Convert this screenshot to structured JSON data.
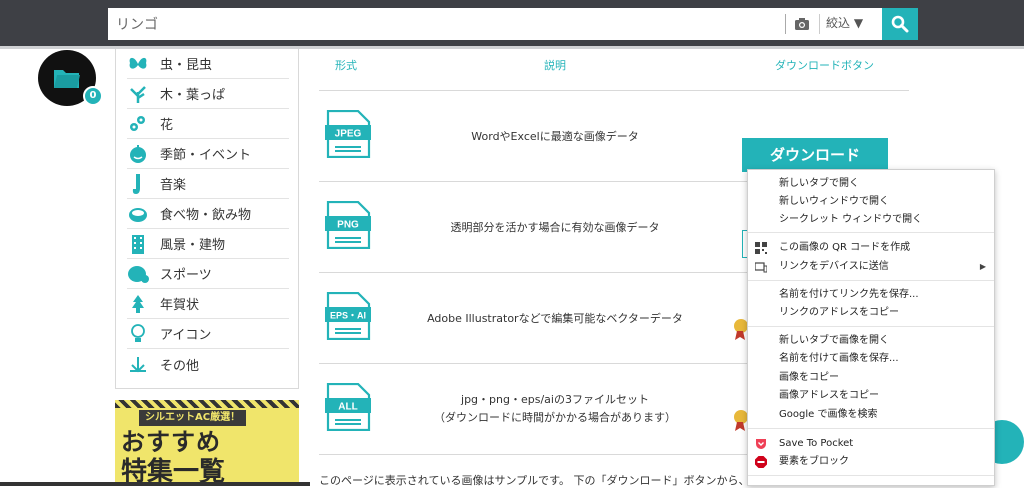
{
  "search": {
    "value": "リンゴ",
    "filter_label": "絞込 ▼"
  },
  "folder": {
    "count": "0"
  },
  "sidebar": {
    "items": [
      {
        "label": "虫・昆虫",
        "icon": "butterfly-icon"
      },
      {
        "label": "木・葉っぱ",
        "icon": "leaf-icon"
      },
      {
        "label": "花",
        "icon": "flower-icon"
      },
      {
        "label": "季節・イベント",
        "icon": "pumpkin-icon"
      },
      {
        "label": "音楽",
        "icon": "saxophone-icon"
      },
      {
        "label": "食べ物・飲み物",
        "icon": "food-icon"
      },
      {
        "label": "風景・建物",
        "icon": "building-icon"
      },
      {
        "label": "スポーツ",
        "icon": "sports-icon"
      },
      {
        "label": "年賀状",
        "icon": "new-year-icon"
      },
      {
        "label": "アイコン",
        "icon": "lightbulb-icon"
      },
      {
        "label": "その他",
        "icon": "other-icon"
      }
    ]
  },
  "banner": {
    "tag": "シルエットAC厳選！",
    "line1": "おすすめ",
    "line2": "特集一覧"
  },
  "table": {
    "headers": {
      "format": "形式",
      "description": "説明",
      "download": "ダウンロードボタン"
    },
    "rows": [
      {
        "format": "JPEG",
        "description": "WordやExcelに最適な画像データ"
      },
      {
        "format": "PNG",
        "description": "透明部分を活かす場合に有効な画像データ"
      },
      {
        "format": "EPS・AI",
        "description": "Adobe Illustratorなどで編集可能なベクターデータ"
      },
      {
        "format": "ALL",
        "description": "jpg・png・eps/aiの3ファイルセット",
        "description2": "（ダウンロードに時間がかかる場合があります）"
      }
    ],
    "download_label": "ダウンロード"
  },
  "footer": {
    "text": "このページに表示されている画像はサンプルです。 下の「ダウンロード」ボタンから、ダ"
  },
  "context_menu": {
    "group1": [
      "新しいタブで開く",
      "新しいウィンドウで開く",
      "シークレット ウィンドウで開く"
    ],
    "group2": [
      "この画像の QR コードを作成",
      "リンクをデバイスに送信"
    ],
    "group3": [
      "名前を付けてリンク先を保存...",
      "リンクのアドレスをコピー"
    ],
    "group4": [
      "新しいタブで画像を開く",
      "名前を付けて画像を保存...",
      "画像をコピー",
      "画像アドレスをコピー",
      "Google で画像を検索"
    ],
    "group5": [
      "Save To Pocket",
      "要素をブロック"
    ]
  },
  "colors": {
    "accent": "#23b3b8",
    "topbar": "#3e4045"
  }
}
